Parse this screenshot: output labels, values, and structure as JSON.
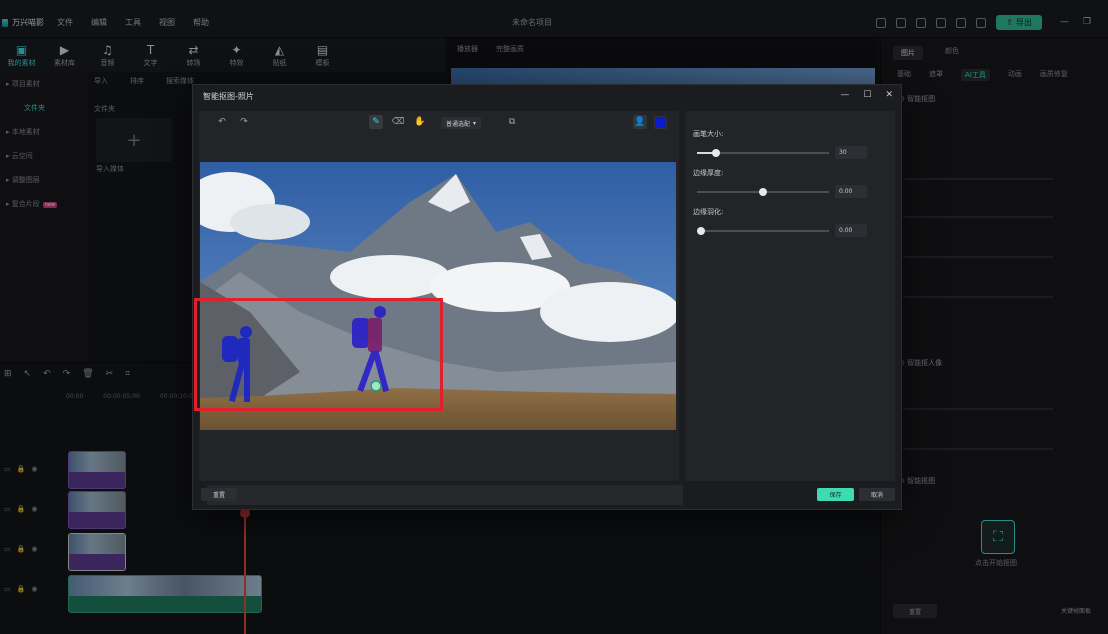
{
  "app": {
    "logo_label": "万兴喵影",
    "menus": [
      "文件",
      "编辑",
      "工具",
      "视图",
      "帮助"
    ],
    "document_title": "未命名项目",
    "export_label": "导出"
  },
  "media_toolbar": {
    "items": [
      {
        "label": "我的素材",
        "icon": "folder-icon"
      },
      {
        "label": "素材库",
        "icon": "library-icon"
      },
      {
        "label": "音频",
        "icon": "music-icon"
      },
      {
        "label": "文字",
        "icon": "text-icon"
      },
      {
        "label": "转场",
        "icon": "transition-icon"
      },
      {
        "label": "特效",
        "icon": "effects-icon"
      },
      {
        "label": "贴纸",
        "icon": "sticker-icon"
      },
      {
        "label": "模板",
        "icon": "template-icon"
      }
    ]
  },
  "left_nav": {
    "items": [
      "项目素材",
      "文件夹",
      "本地素材",
      "云空间",
      "调整图层",
      "复合片段"
    ],
    "new_tag": "new"
  },
  "media": {
    "import_label": "导入",
    "sort_label": "排序",
    "search_placeholder": "搜索媒体",
    "folder_label": "文件夹",
    "import_tile_label": "导入媒体"
  },
  "player": {
    "tabs": [
      "播放器",
      "完整画质"
    ]
  },
  "properties": {
    "tabs_top": [
      "图片",
      "颜色"
    ],
    "tabs_sub": [
      "基础",
      "遮罩",
      "AI工具",
      "动画",
      "画质修复"
    ],
    "section_smart_cutout": "智能抠图",
    "section_smart_portrait": "智能抠人像",
    "section_ai_cutout": "智能抠图",
    "start_cutout_label": "点击开始抠图",
    "reset_label": "重置",
    "keyframe_label": "关键帧面板"
  },
  "dialog": {
    "title": "智能抠图-照片",
    "mode_label": "普通选配",
    "color_hex": "#0a1acc",
    "settings": {
      "brush_size_label": "画笔大小:",
      "brush_size_value": "30",
      "brush_size_level": 0.12,
      "edge_thickness_label": "边缘厚度:",
      "edge_thickness_value": "0.00",
      "edge_thickness_level": 0.5,
      "edge_feather_label": "边缘羽化:",
      "edge_feather_value": "0.00",
      "edge_feather_level": 0.0
    },
    "reset_label": "重置",
    "save_label": "保存",
    "cancel_label": "取消"
  },
  "timeline": {
    "ruler": [
      "00:00",
      "00:00:05:00",
      "00:00:10:00"
    ]
  }
}
